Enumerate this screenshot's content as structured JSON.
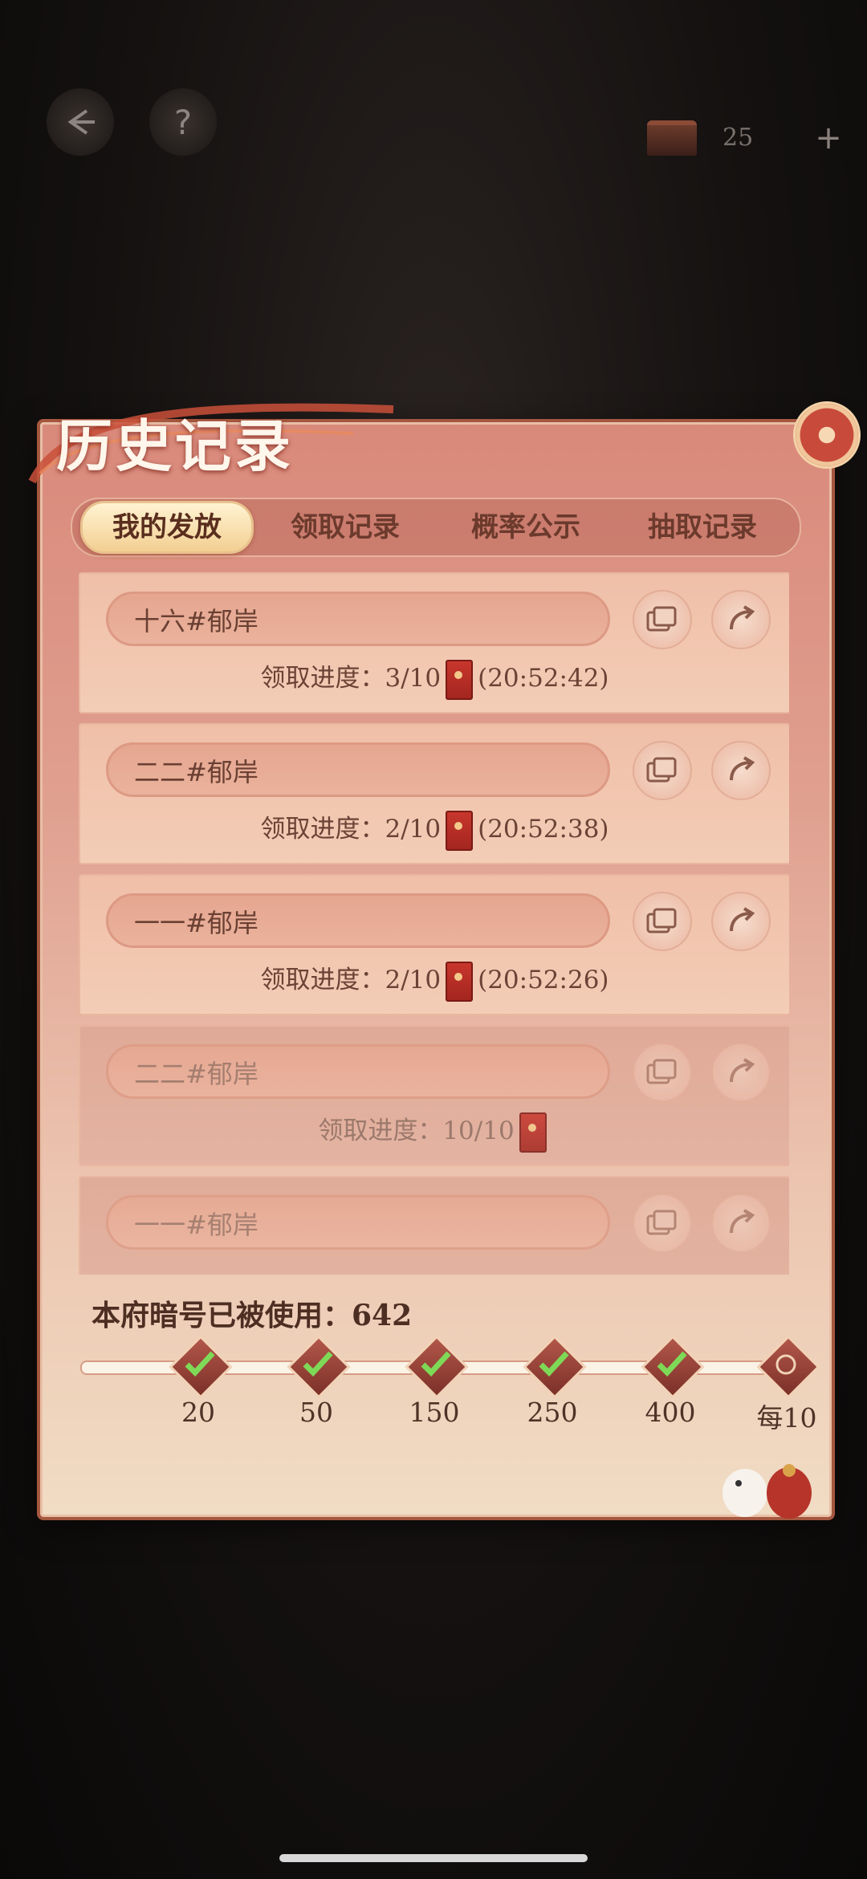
{
  "header": {
    "count": "25",
    "plus": "+"
  },
  "panel": {
    "title": "历史记录"
  },
  "tabs": [
    {
      "label": "我的发放",
      "active": true
    },
    {
      "label": "领取记录",
      "active": false
    },
    {
      "label": "概率公示",
      "active": false
    },
    {
      "label": "抽取记录",
      "active": false
    }
  ],
  "records": [
    {
      "name": "十六#郁岸",
      "progress": "领取进度：3/10",
      "time": "(20:52:42)",
      "completed": false
    },
    {
      "name": "二二#郁岸",
      "progress": "领取进度：2/10",
      "time": "(20:52:38)",
      "completed": false
    },
    {
      "name": "一一#郁岸",
      "progress": "领取进度：2/10",
      "time": "(20:52:26)",
      "completed": false
    },
    {
      "name": "二二#郁岸",
      "progress": "领取进度：10/10",
      "time": "",
      "completed": true
    },
    {
      "name": "一一#郁岸",
      "progress": "",
      "time": "",
      "completed": true
    }
  ],
  "usage": {
    "label": "本府暗号已被使用：642"
  },
  "milestones": [
    {
      "label": "20",
      "achieved": true
    },
    {
      "label": "50",
      "achieved": true
    },
    {
      "label": "150",
      "achieved": true
    },
    {
      "label": "250",
      "achieved": true
    },
    {
      "label": "400",
      "achieved": true
    },
    {
      "label": "每10",
      "achieved": false
    }
  ],
  "colors": {
    "accent": "#c84a3a",
    "panel": "#e0a090",
    "check": "#7ed957"
  }
}
